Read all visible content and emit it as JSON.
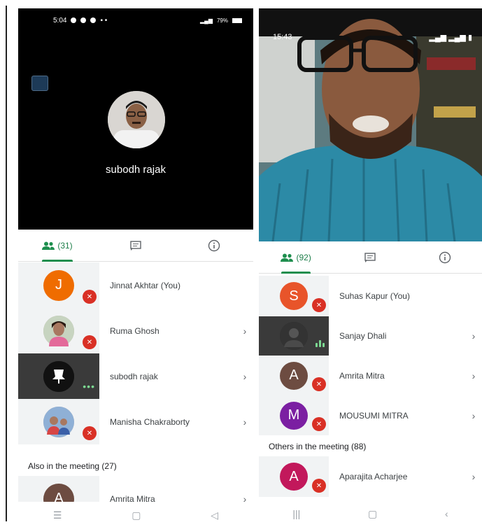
{
  "left": {
    "status": {
      "time": "5:04",
      "battery": "79%"
    },
    "speaker_name": "subodh rajak",
    "tabs": {
      "people_count": "(31)"
    },
    "participants": [
      {
        "initial": "J",
        "name": "Jinnat Akhtar (You)",
        "color": "#ef6c00",
        "photo": false,
        "state": "muted",
        "tile": "light",
        "chevron": false
      },
      {
        "initial": "",
        "name": "Ruma Ghosh",
        "color": "#b9a79a",
        "photo": true,
        "state": "muted",
        "tile": "light",
        "chevron": true
      },
      {
        "initial": "",
        "name": "subodh rajak",
        "color": "#222222",
        "photo": true,
        "state": "speaking",
        "tile": "dark",
        "chevron": true
      },
      {
        "initial": "",
        "name": "Manisha Chakraborty",
        "color": "#7a6aa0",
        "photo": true,
        "state": "muted",
        "tile": "light",
        "chevron": true
      }
    ],
    "also_title": "Also in the meeting (27)",
    "also": [
      {
        "initial": "A",
        "name": "Amrita Mitra",
        "color": "#6d4c41"
      }
    ]
  },
  "right": {
    "status": {
      "time": "15:43"
    },
    "tabs": {
      "people_count": "(92)"
    },
    "participants": [
      {
        "initial": "S",
        "name": "Suhas Kapur (You)",
        "color": "#e8542a",
        "photo": false,
        "state": "muted",
        "tile": "light",
        "chevron": false
      },
      {
        "initial": "",
        "name": "Sanjay Dhali",
        "color": "#2a2a2a",
        "photo": true,
        "state": "speaking",
        "tile": "dark",
        "chevron": true
      },
      {
        "initial": "A",
        "name": "Amrita Mitra",
        "color": "#6d4c41",
        "photo": false,
        "state": "muted",
        "tile": "light",
        "chevron": true
      },
      {
        "initial": "M",
        "name": "MOUSUMI MITRA",
        "color": "#7b1fa2",
        "photo": false,
        "state": "muted",
        "tile": "light",
        "chevron": true
      }
    ],
    "others_title": "Others in the meeting (88)",
    "others": [
      {
        "initial": "A",
        "name": "Aparajita Acharjee",
        "color": "#c2185b",
        "photo": false,
        "state": "muted",
        "tile": "light",
        "chevron": true
      }
    ]
  },
  "icons": {
    "people": "people-icon",
    "chat": "chat-icon",
    "info": "info-icon",
    "mic_off": "mic-off-icon",
    "chevron": "chevron-right-icon"
  },
  "colors": {
    "accent": "#1e8e4e",
    "mute_red": "#d93025",
    "speaking_green": "#7cd992"
  }
}
